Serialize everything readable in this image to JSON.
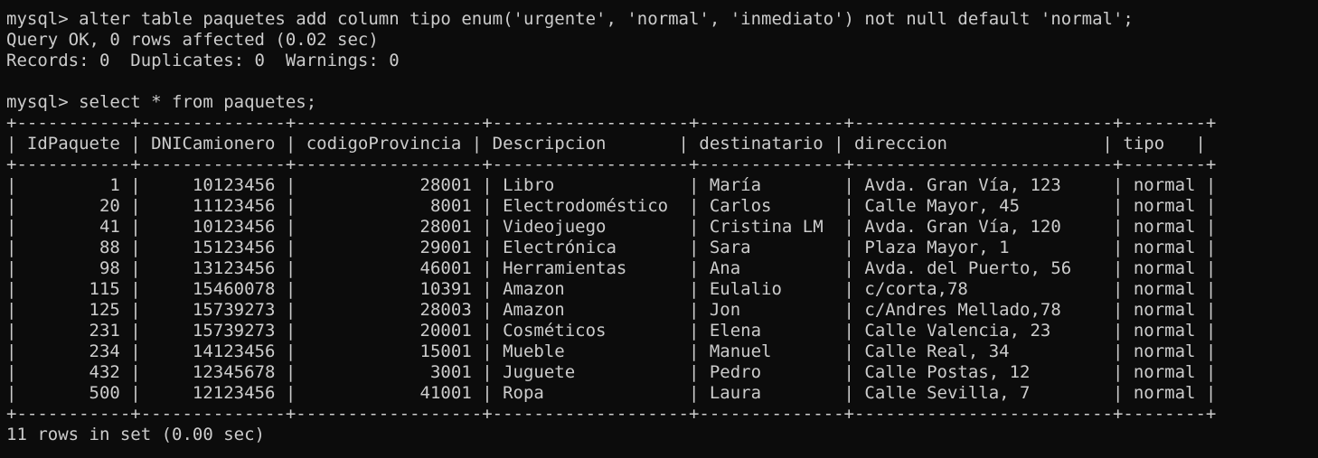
{
  "terminal": {
    "lines": [
      "mysql> alter table paquetes add column tipo enum('urgente', 'normal', 'inmediato') not null default 'normal';",
      "Query OK, 0 rows affected (0.02 sec)",
      "Records: 0  Duplicates: 0  Warnings: 0",
      "",
      "mysql> select * from paquetes;",
      "+-----------+--------------+------------------+-------------------+--------------+-------------------------+--------+",
      "| IdPaquete | DNICamionero | codigoProvincia | Descripcion       | destinatario | direccion               | tipo   |",
      "+-----------+--------------+------------------+-------------------+--------------+-------------------------+--------+",
      "|         1 |     10123456 |            28001 | Libro             | María        | Avda. Gran Vía, 123     | normal |",
      "|        20 |     11123456 |             8001 | Electrodoméstico  | Carlos       | Calle Mayor, 45         | normal |",
      "|        41 |     10123456 |            28001 | Videojuego        | Cristina LM  | Avda. Gran Vía, 120     | normal |",
      "|        88 |     15123456 |            29001 | Electrónica       | Sara         | Plaza Mayor, 1          | normal |",
      "|        98 |     13123456 |            46001 | Herramientas      | Ana          | Avda. del Puerto, 56    | normal |",
      "|       115 |     15460078 |            10391 | Amazon            | Eulalio      | c/corta,78              | normal |",
      "|       125 |     15739273 |            28003 | Amazon            | Jon          | c/Andres Mellado,78     | normal |",
      "|       231 |     15739273 |            20001 | Cosméticos        | Elena        | Calle Valencia, 23      | normal |",
      "|       234 |     14123456 |            15001 | Mueble            | Manuel       | Calle Real, 34          | normal |",
      "|       432 |     12345678 |             3001 | Juguete           | Pedro        | Calle Postas, 12        | normal |",
      "|       500 |     12123456 |            41001 | Ropa              | Laura        | Calle Sevilla, 7        | normal |",
      "+-----------+--------------+------------------+-------------------+--------------+-------------------------+--------+",
      "11 rows in set (0.00 sec)"
    ]
  }
}
